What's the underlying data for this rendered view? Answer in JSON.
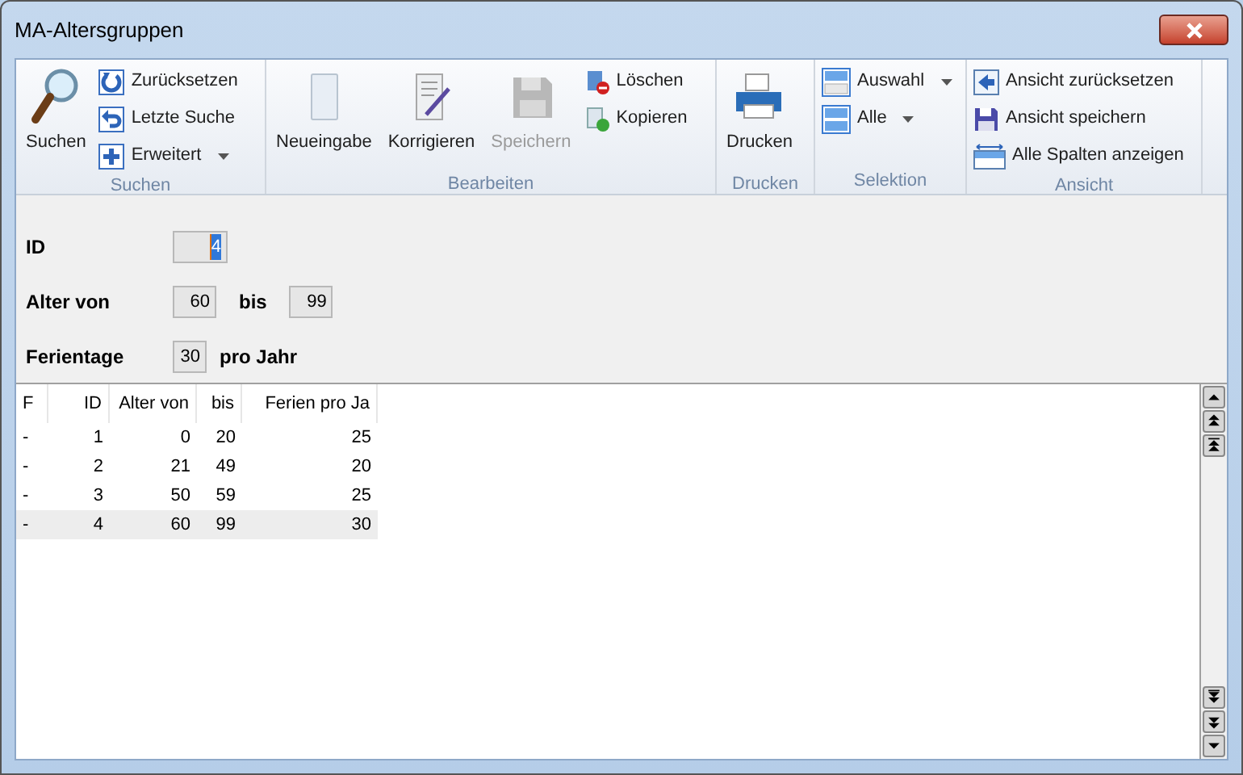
{
  "window": {
    "title": "MA-Altersgruppen"
  },
  "ribbon": [
    {
      "label": "Suchen",
      "items": [
        {
          "label": "Suchen",
          "kind": "large",
          "disabled": false
        },
        {
          "label": "Zurücksetzen",
          "kind": "small",
          "disabled": false
        },
        {
          "label": "Letzte Suche",
          "kind": "small",
          "disabled": false
        },
        {
          "label": "Erweitert",
          "kind": "dropdown",
          "disabled": false
        }
      ]
    },
    {
      "label": "Bearbeiten",
      "items": [
        {
          "label": "Neueingabe",
          "kind": "large",
          "disabled": false
        },
        {
          "label": "Korrigieren",
          "kind": "large",
          "disabled": false
        },
        {
          "label": "Speichern",
          "kind": "large",
          "disabled": true
        },
        {
          "label": "Löschen",
          "kind": "small",
          "disabled": false
        },
        {
          "label": "Kopieren",
          "kind": "small",
          "disabled": false
        }
      ]
    },
    {
      "label": "Drucken",
      "items": [
        {
          "label": "Drucken",
          "kind": "large",
          "disabled": false
        }
      ]
    },
    {
      "label": "Selektion",
      "items": [
        {
          "label": "Auswahl",
          "kind": "dropdown",
          "disabled": false
        },
        {
          "label": "Alle",
          "kind": "dropdown",
          "disabled": false
        }
      ]
    },
    {
      "label": "Ansicht",
      "items": [
        {
          "label": "Ansicht zurücksetzen",
          "kind": "small",
          "disabled": false
        },
        {
          "label": "Ansicht speichern",
          "kind": "small",
          "disabled": false
        },
        {
          "label": "Alle Spalten anzeigen",
          "kind": "small",
          "disabled": false
        }
      ]
    }
  ],
  "form": {
    "id": {
      "label": "ID",
      "value": "4",
      "focused": true
    },
    "age": {
      "label": "Alter von",
      "from": "60",
      "to_label": "bis",
      "to": "99"
    },
    "vacation": {
      "label": "Ferientage",
      "value": "30",
      "suffix": "pro Jahr"
    }
  },
  "table": {
    "columns": [
      "F",
      "ID",
      "Alter von",
      "bis",
      "Ferien pro Ja"
    ],
    "rows": [
      {
        "cells": [
          "-",
          "1",
          "0",
          "20",
          "25"
        ],
        "selected": false
      },
      {
        "cells": [
          "-",
          "2",
          "21",
          "49",
          "20"
        ],
        "selected": false
      },
      {
        "cells": [
          "-",
          "3",
          "50",
          "59",
          "25"
        ],
        "selected": false
      },
      {
        "cells": [
          "-",
          "4",
          "60",
          "99",
          "30"
        ],
        "selected": true
      }
    ]
  }
}
